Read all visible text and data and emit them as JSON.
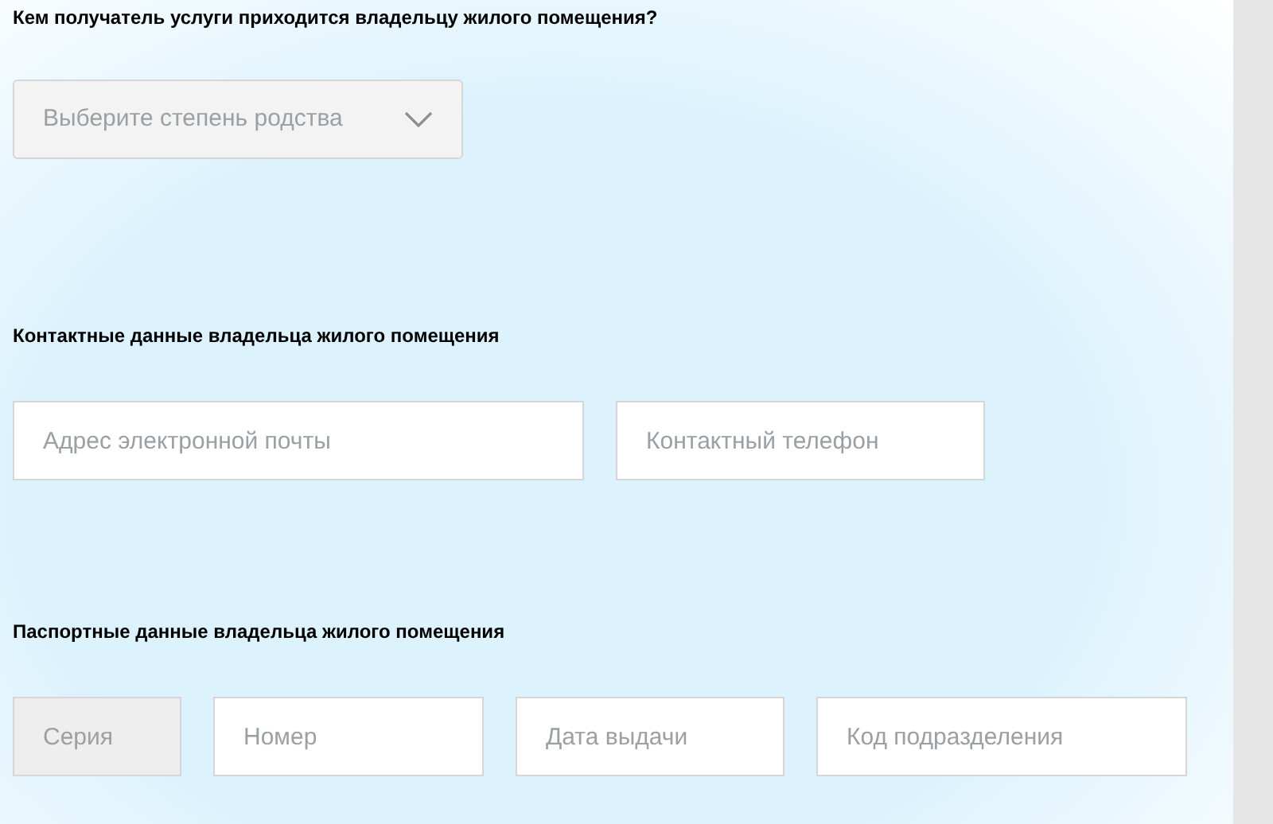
{
  "sections": [
    {
      "title": "Кем получатель услуги приходится владельцу жилого помещения?",
      "fields": [
        {
          "kind": "select",
          "placeholder": "Выберите степень родства",
          "disabled": false
        }
      ]
    },
    {
      "title": "Контактные данные владельца жилого помещения",
      "fields": [
        {
          "kind": "input",
          "placeholder": "Адрес электронной почты",
          "disabled": false
        },
        {
          "kind": "input",
          "placeholder": "Контактный телефон",
          "disabled": false
        }
      ]
    },
    {
      "title": "Паспортные данные владельца жилого помещения",
      "fields": [
        {
          "kind": "input",
          "placeholder": "Серия",
          "disabled": true
        },
        {
          "kind": "input",
          "placeholder": "Номер",
          "disabled": false
        },
        {
          "kind": "input",
          "placeholder": "Дата выдачи",
          "disabled": false
        },
        {
          "kind": "input",
          "placeholder": "Код подразделения",
          "disabled": false
        }
      ]
    }
  ]
}
